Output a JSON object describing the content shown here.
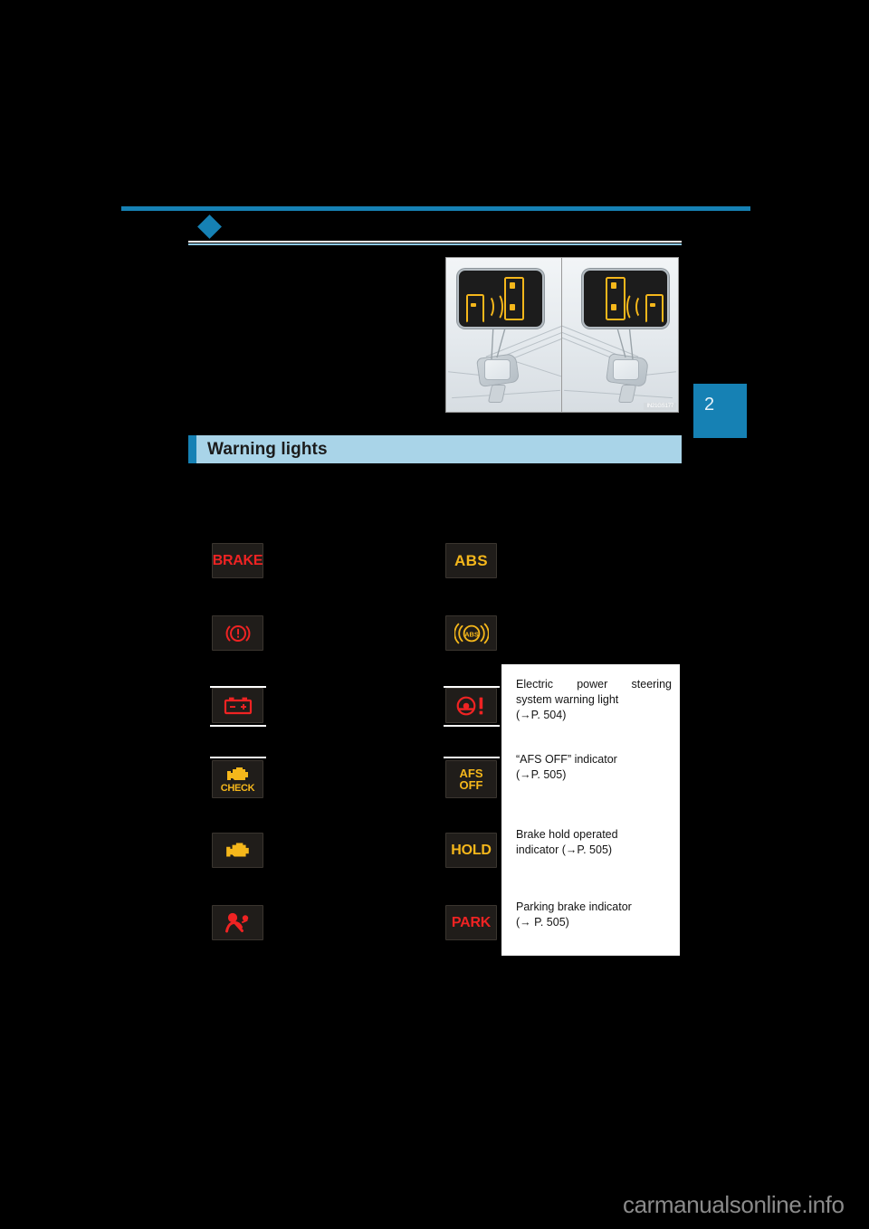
{
  "page": {
    "background_color": "#000000",
    "accent_color": "#1681b4",
    "band_color": "#a9d4e8",
    "chapter_number": "2",
    "watermark": "carmanualsonline.info"
  },
  "illustration": {
    "name": "blind-spot-monitor-mirror-indicators",
    "code": "IN21GS177",
    "panels": [
      {
        "label": "left-mirror-outside-rear-view-monitor",
        "side": "left"
      },
      {
        "label": "right-mirror-outside-rear-view-monitor",
        "side": "right"
      }
    ]
  },
  "section": {
    "title": "Warning lights"
  },
  "warning_lights": {
    "rows": [
      {
        "left": {
          "icon": "brake-warning-light",
          "label": "BRAKE",
          "color": "#ef2323",
          "style": "text"
        },
        "right": {
          "icon": "abs-warning-light",
          "label": "ABS",
          "color": "#f5b71b",
          "style": "text"
        }
      },
      {
        "left": {
          "icon": "brake-system-circle-exclamation-light",
          "label": "",
          "color": "#ef2323",
          "style": "glyph"
        },
        "right": {
          "icon": "abs-circle-waves-light",
          "label": "ABS",
          "color": "#f5b71b",
          "style": "glyph"
        }
      },
      {
        "left": {
          "icon": "charging-system-battery-light",
          "label": "",
          "color": "#ef2323",
          "style": "glyph"
        },
        "right": {
          "icon": "electric-power-steering-warning-light",
          "label": "",
          "color": "#ef2323",
          "style": "glyph"
        }
      },
      {
        "left": {
          "icon": "check-engine-light",
          "label": "CHECK",
          "color": "#f5b71b",
          "style": "glyph"
        },
        "right": {
          "icon": "afs-off-indicator",
          "label": "AFS OFF",
          "color": "#f5b71b",
          "style": "text"
        }
      },
      {
        "left": {
          "icon": "malfunction-indicator-lamp",
          "label": "",
          "color": "#f5b71b",
          "style": "glyph"
        },
        "right": {
          "icon": "brake-hold-operated-indicator",
          "label": "HOLD",
          "color": "#f5b71b",
          "style": "text"
        }
      },
      {
        "left": {
          "icon": "srs-airbag-warning-light",
          "label": "",
          "color": "#ef2323",
          "style": "glyph"
        },
        "right": {
          "icon": "parking-brake-indicator",
          "label": "PARK",
          "color": "#ef2323",
          "style": "text"
        }
      }
    ]
  },
  "info_panel": {
    "items": [
      {
        "name": "electric-power-steering-entry",
        "line1": "Electric power steering",
        "line2": "system warning light",
        "line3": "(→P. 504)"
      },
      {
        "name": "afs-off-entry",
        "line1": "“AFS OFF” indicator",
        "line2": "(→P. 505)",
        "line3": ""
      },
      {
        "name": "brake-hold-entry",
        "line1": "Brake hold operated",
        "line2": "indicator (→P. 505)",
        "line3": ""
      },
      {
        "name": "parking-brake-entry",
        "line1": "Parking brake indicator",
        "line2": "(→ P. 505)",
        "line3": ""
      }
    ]
  }
}
